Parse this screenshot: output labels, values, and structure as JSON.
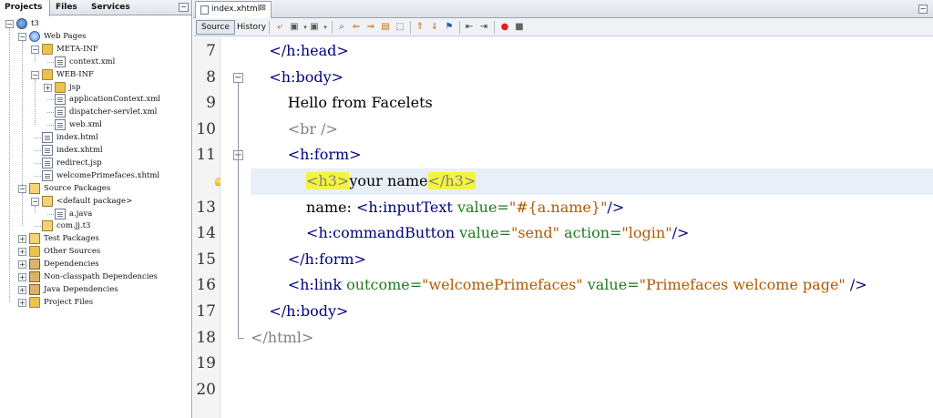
{
  "project_panel": {
    "tabs": [
      "Projects",
      "Files",
      "Services"
    ],
    "active_tab": "Projects",
    "tree": [
      {
        "label": "t3",
        "depth": 0,
        "icon": "project-icon",
        "toggle": "−"
      },
      {
        "label": "Web Pages",
        "depth": 1,
        "icon": "globe-folder-icon",
        "toggle": "−"
      },
      {
        "label": "META-INF",
        "depth": 2,
        "icon": "folder-icon",
        "toggle": "−"
      },
      {
        "label": "context.xml",
        "depth": 3,
        "icon": "xml-file-icon",
        "toggle": ""
      },
      {
        "label": "WEB-INF",
        "depth": 2,
        "icon": "folder-icon",
        "toggle": "−"
      },
      {
        "label": "jsp",
        "depth": 3,
        "icon": "folder-icon",
        "toggle": "+"
      },
      {
        "label": "applicationContext.xml",
        "depth": 3,
        "icon": "xml-file-icon",
        "toggle": ""
      },
      {
        "label": "dispatcher-servlet.xml",
        "depth": 3,
        "icon": "xml-file-icon",
        "toggle": ""
      },
      {
        "label": "web.xml",
        "depth": 3,
        "icon": "xml-file-icon",
        "toggle": ""
      },
      {
        "label": "index.html",
        "depth": 2,
        "icon": "html-file-icon",
        "toggle": ""
      },
      {
        "label": "index.xhtml",
        "depth": 2,
        "icon": "html-file-icon",
        "toggle": ""
      },
      {
        "label": "redirect.jsp",
        "depth": 2,
        "icon": "jsp-file-icon",
        "toggle": ""
      },
      {
        "label": "welcomePrimefaces.xhtml",
        "depth": 2,
        "icon": "html-file-icon",
        "toggle": ""
      },
      {
        "label": "Source Packages",
        "depth": 1,
        "icon": "package-folder-icon",
        "toggle": "−"
      },
      {
        "label": "<default package>",
        "depth": 2,
        "icon": "package-icon",
        "toggle": "−"
      },
      {
        "label": "a.java",
        "depth": 3,
        "icon": "java-file-icon",
        "toggle": ""
      },
      {
        "label": "com.jj.t3",
        "depth": 2,
        "icon": "package-icon",
        "toggle": ""
      },
      {
        "label": "Test Packages",
        "depth": 1,
        "icon": "package-folder-icon",
        "toggle": "+"
      },
      {
        "label": "Other Sources",
        "depth": 1,
        "icon": "folder-icon",
        "toggle": "+"
      },
      {
        "label": "Dependencies",
        "depth": 1,
        "icon": "jar-folder-icon",
        "toggle": "+"
      },
      {
        "label": "Non-classpath Dependencies",
        "depth": 1,
        "icon": "jar-folder-icon",
        "toggle": "+"
      },
      {
        "label": "Java Dependencies",
        "depth": 1,
        "icon": "jar-folder-icon",
        "toggle": "+"
      },
      {
        "label": "Project Files",
        "depth": 1,
        "icon": "folder-icon",
        "toggle": "+"
      }
    ]
  },
  "editor": {
    "file_tab": {
      "name": "index.xhtml",
      "close": "⊠"
    },
    "toolbar": {
      "source_label": "Source",
      "history_label": "History"
    },
    "lines": [
      {
        "n": "7",
        "fold": "",
        "parts": [
          {
            "t": "    ",
            "c": "t-txt"
          },
          {
            "t": "</h:head>",
            "c": "t-tag"
          }
        ]
      },
      {
        "n": "8",
        "fold": "−",
        "parts": [
          {
            "t": "    ",
            "c": "t-txt"
          },
          {
            "t": "<h:body>",
            "c": "t-tag"
          }
        ]
      },
      {
        "n": "9",
        "fold": "",
        "parts": [
          {
            "t": "        Hello from Facelets",
            "c": "t-txt"
          }
        ]
      },
      {
        "n": "10",
        "fold": "",
        "parts": [
          {
            "t": "        ",
            "c": "t-txt"
          },
          {
            "t": "<br />",
            "c": "t-el"
          }
        ]
      },
      {
        "n": "11",
        "fold": "−",
        "parts": [
          {
            "t": "        ",
            "c": "t-txt"
          },
          {
            "t": "<h:form>",
            "c": "t-tag"
          }
        ]
      },
      {
        "n": "",
        "fold": "",
        "hl": true,
        "bulb": true,
        "parts": [
          {
            "t": "            ",
            "c": "t-txt"
          },
          {
            "t": "<h3>",
            "c": "t-el mark"
          },
          {
            "t": "your name",
            "c": "t-txt"
          },
          {
            "t": "</h3>",
            "c": "t-el mark"
          }
        ]
      },
      {
        "n": "13",
        "fold": "",
        "parts": [
          {
            "t": "            name: ",
            "c": "t-txt"
          },
          {
            "t": "<h:inputText",
            "c": "t-tag"
          },
          {
            "t": " value=",
            "c": "t-attr"
          },
          {
            "t": "\"#{a.name}\"",
            "c": "t-val"
          },
          {
            "t": "/>",
            "c": "t-tag"
          }
        ]
      },
      {
        "n": "14",
        "fold": "",
        "parts": [
          {
            "t": "            ",
            "c": "t-txt"
          },
          {
            "t": "<h:commandButton",
            "c": "t-tag"
          },
          {
            "t": " value=",
            "c": "t-attr"
          },
          {
            "t": "\"send\"",
            "c": "t-val"
          },
          {
            "t": " action=",
            "c": "t-attr"
          },
          {
            "t": "\"login\"",
            "c": "t-val"
          },
          {
            "t": "/>",
            "c": "t-tag"
          }
        ]
      },
      {
        "n": "15",
        "fold": "",
        "parts": [
          {
            "t": "        ",
            "c": "t-txt"
          },
          {
            "t": "</h:form>",
            "c": "t-tag"
          }
        ]
      },
      {
        "n": "16",
        "fold": "",
        "parts": [
          {
            "t": "        ",
            "c": "t-txt"
          },
          {
            "t": "<h:link",
            "c": "t-tag"
          },
          {
            "t": " outcome=",
            "c": "t-attr"
          },
          {
            "t": "\"welcomePrimefaces\"",
            "c": "t-val"
          },
          {
            "t": " value=",
            "c": "t-attr"
          },
          {
            "t": "\"Primefaces welcome page\"",
            "c": "t-val"
          },
          {
            "t": " />",
            "c": "t-tag"
          }
        ]
      },
      {
        "n": "17",
        "fold": "",
        "parts": [
          {
            "t": "    ",
            "c": "t-txt"
          },
          {
            "t": "</h:body>",
            "c": "t-tag"
          }
        ]
      },
      {
        "n": "18",
        "fold": "",
        "parts": [
          {
            "t": "</html>",
            "c": "t-el"
          }
        ]
      },
      {
        "n": "19",
        "fold": "",
        "parts": []
      },
      {
        "n": "20",
        "fold": "",
        "parts": []
      }
    ]
  }
}
